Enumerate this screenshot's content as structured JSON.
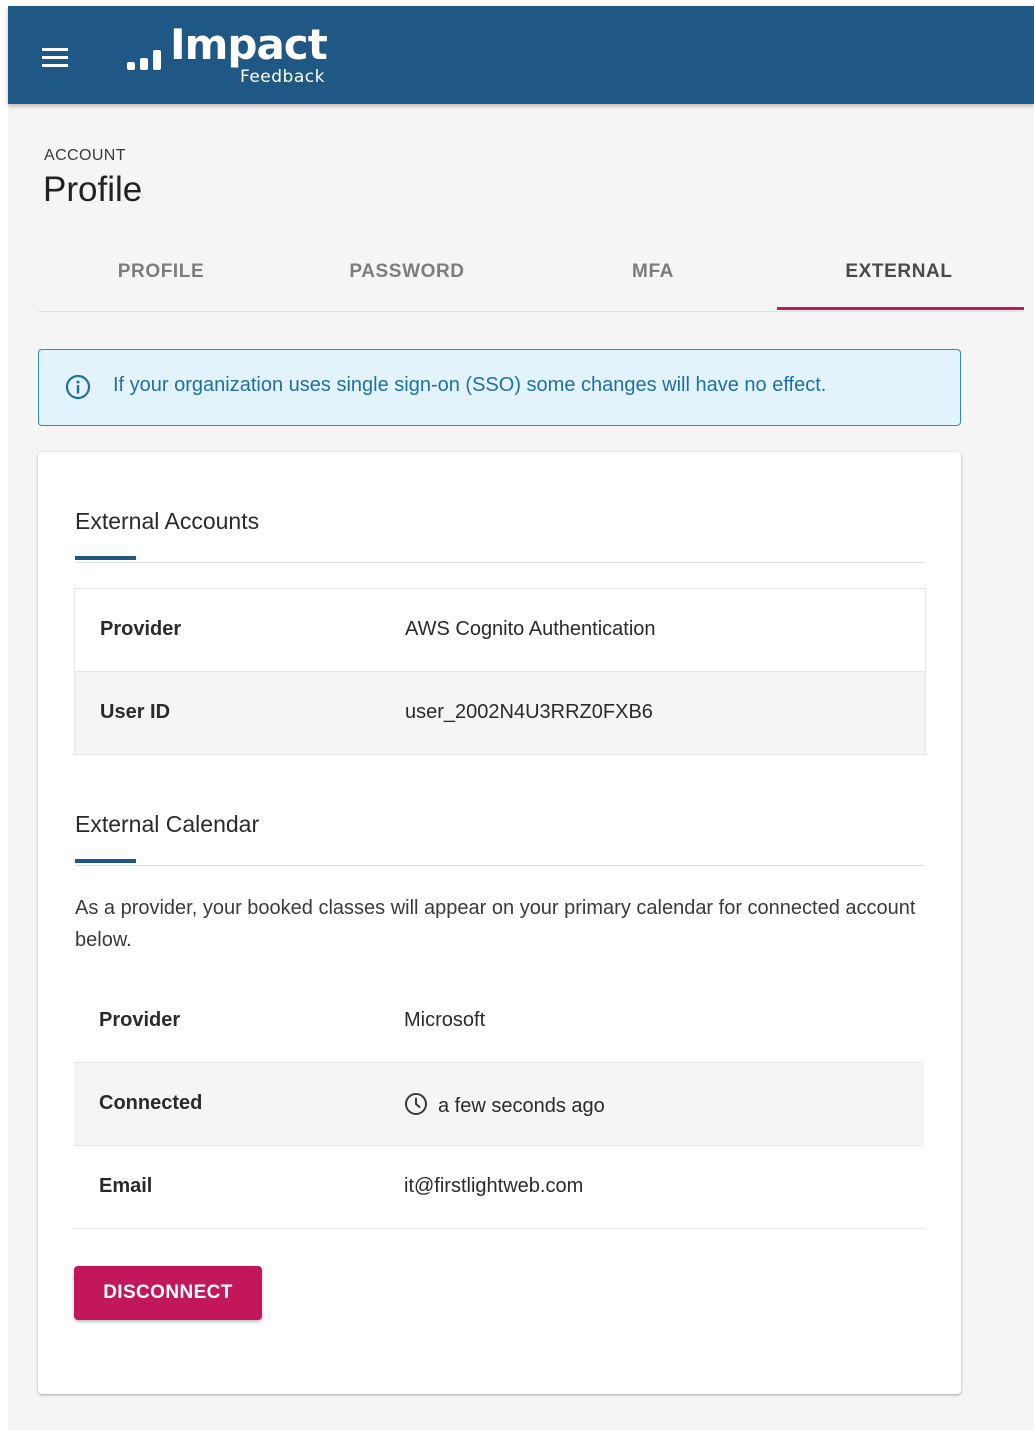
{
  "app": {
    "logo_text": "Impact",
    "logo_subtext": "Feedback",
    "menu_icon": "hamburger-menu-icon"
  },
  "header": {
    "overline": "ACCOUNT",
    "title": "Profile"
  },
  "tabs": {
    "items": [
      {
        "label": "PROFILE"
      },
      {
        "label": "PASSWORD"
      },
      {
        "label": "MFA"
      },
      {
        "label": "EXTERNAL"
      }
    ],
    "active_index": 3
  },
  "alert": {
    "icon": "info-icon",
    "text": "If your organization uses single sign-on (SSO) some changes will have no effect."
  },
  "external_accounts": {
    "heading": "External Accounts",
    "rows": [
      {
        "key": "Provider",
        "value": "AWS Cognito Authentication"
      },
      {
        "key": "User ID",
        "value": "user_2002N4U3RRZ0FXB6"
      }
    ]
  },
  "external_calendar": {
    "heading": "External Calendar",
    "description": "As a provider, your booked classes will appear on your primary calendar for connected account below.",
    "rows": [
      {
        "key": "Provider",
        "value": "Microsoft"
      },
      {
        "key": "Connected",
        "value": "a few seconds ago",
        "icon": "clock-icon"
      },
      {
        "key": "Email",
        "value": "it@firstlightweb.com"
      }
    ],
    "disconnect_label": "DISCONNECT"
  },
  "colors": {
    "app_bar": "#1f5785",
    "accent": "#c2185b",
    "info_border": "#2a8ccc",
    "info_background": "#e3f3fc"
  }
}
